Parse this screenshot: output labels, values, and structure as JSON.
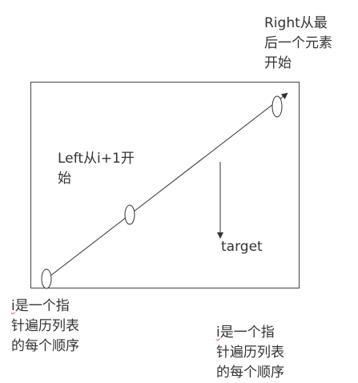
{
  "labels": {
    "right_start": "Right从最\n后一个元素\n开始",
    "left_start": "Left从i+1开\n始",
    "target": "target",
    "i_pointer_left_first": "i",
    "i_pointer_left_rest": "是一个指\n针遍历列表\n的每个顺序",
    "i_pointer_right_first": "i",
    "i_pointer_right_rest": "是一个指\n针遍历列表\n的每个顺序"
  }
}
